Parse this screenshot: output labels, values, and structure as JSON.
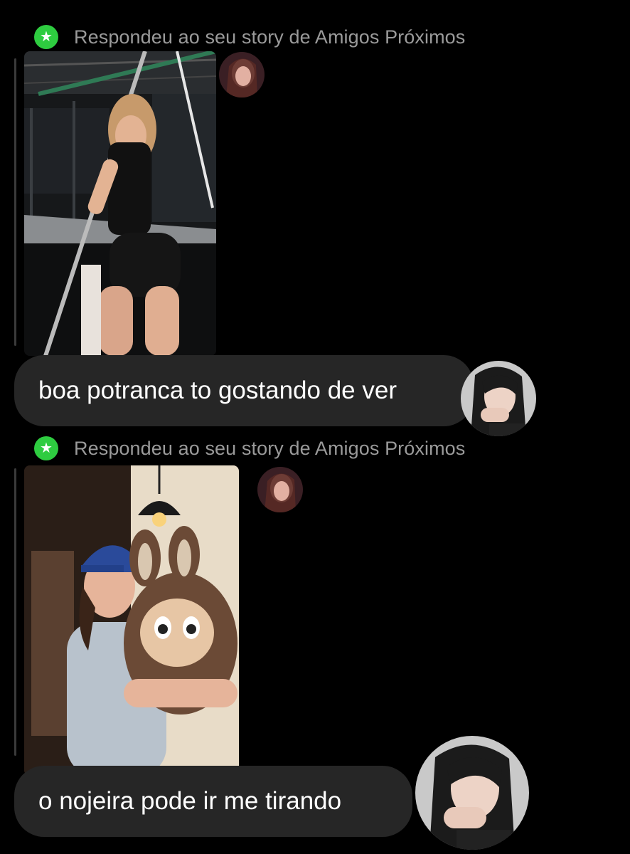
{
  "thread": [
    {
      "context_label": "Respondeu ao seu story de Amigos Próximos",
      "badge_icon": "star-icon",
      "badge_color": "#2ecc40",
      "story_image": "story-photo-woman-on-stage",
      "message": "boa potranca to gostando de ver"
    },
    {
      "context_label": "Respondeu ao seu story de Amigos Próximos",
      "badge_icon": "star-icon",
      "badge_color": "#2ecc40",
      "story_image": "story-photo-woman-hugging-plush",
      "message": "o nojeira pode ir me tirando"
    }
  ],
  "colors": {
    "background": "#000000",
    "bubble": "#262626",
    "context_text": "#9a9a9a",
    "message_text": "#ffffff"
  }
}
